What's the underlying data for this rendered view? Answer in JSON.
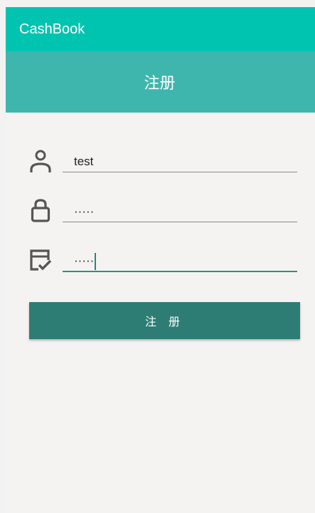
{
  "app_bar": {
    "title": "CashBook"
  },
  "header": {
    "title": "注册"
  },
  "form": {
    "username": {
      "icon": "person-icon",
      "value": "test"
    },
    "password": {
      "icon": "lock-icon",
      "value": "·····"
    },
    "confirm_password": {
      "icon": "checkbox-verify-icon",
      "value": "·····"
    },
    "register_label": "注 册"
  },
  "colors": {
    "app_bar": "#00c4b0",
    "header": "#3fb6ad",
    "button": "#2e7d74",
    "focus_underline": "#2f8f85"
  }
}
